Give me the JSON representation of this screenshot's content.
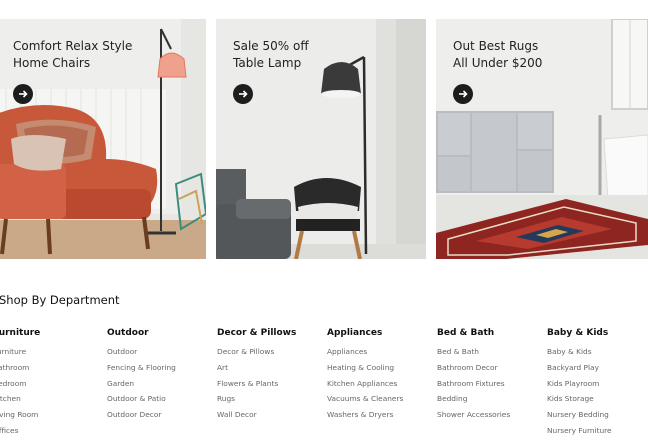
{
  "banners": [
    {
      "title": "Comfort Relax Style\nHome Chairs",
      "button_icon": "arrow-right-icon"
    },
    {
      "title": "Sale 50% off\nTable Lamp",
      "button_icon": "arrow-right-icon"
    },
    {
      "title": "Out Best Rugs\nAll Under $200",
      "button_icon": "arrow-right-icon"
    }
  ],
  "department": {
    "title": "Shop By Department",
    "columns": [
      {
        "heading": "Furniture",
        "items": [
          "Furniture",
          "Bathroom",
          "Bedroom",
          "Kitchen",
          "Living Room",
          "Offices"
        ]
      },
      {
        "heading": "Outdoor",
        "items": [
          "Outdoor",
          "Fencing & Flooring",
          "Garden",
          "Outdoor & Patio",
          "Outdoor Decor"
        ]
      },
      {
        "heading": "Decor & Pillows",
        "items": [
          "Decor & Pillows",
          "Art",
          "Flowers & Plants",
          "Rugs",
          "Wall Decor"
        ]
      },
      {
        "heading": "Appliances",
        "items": [
          "Appliances",
          "Heating & Cooling",
          "Kitchen Appliances",
          "Vacuums & Cleaners",
          "Washers & Dryers"
        ]
      },
      {
        "heading": "Bed & Bath",
        "items": [
          "Bed & Bath",
          "Bathroom Decor",
          "Bathroom Fixtures",
          "Bedding",
          "Shower Accessories"
        ]
      },
      {
        "heading": "Baby & Kids",
        "items": [
          "Baby & Kids",
          "Backyard Play",
          "Kids Playroom",
          "Kids Storage",
          "Nursery Bedding",
          "Nursery Furniture"
        ]
      }
    ]
  },
  "colors": {
    "chair": "#c8583a",
    "rug": "#9b2a22",
    "dark": "#1d1d1d"
  }
}
